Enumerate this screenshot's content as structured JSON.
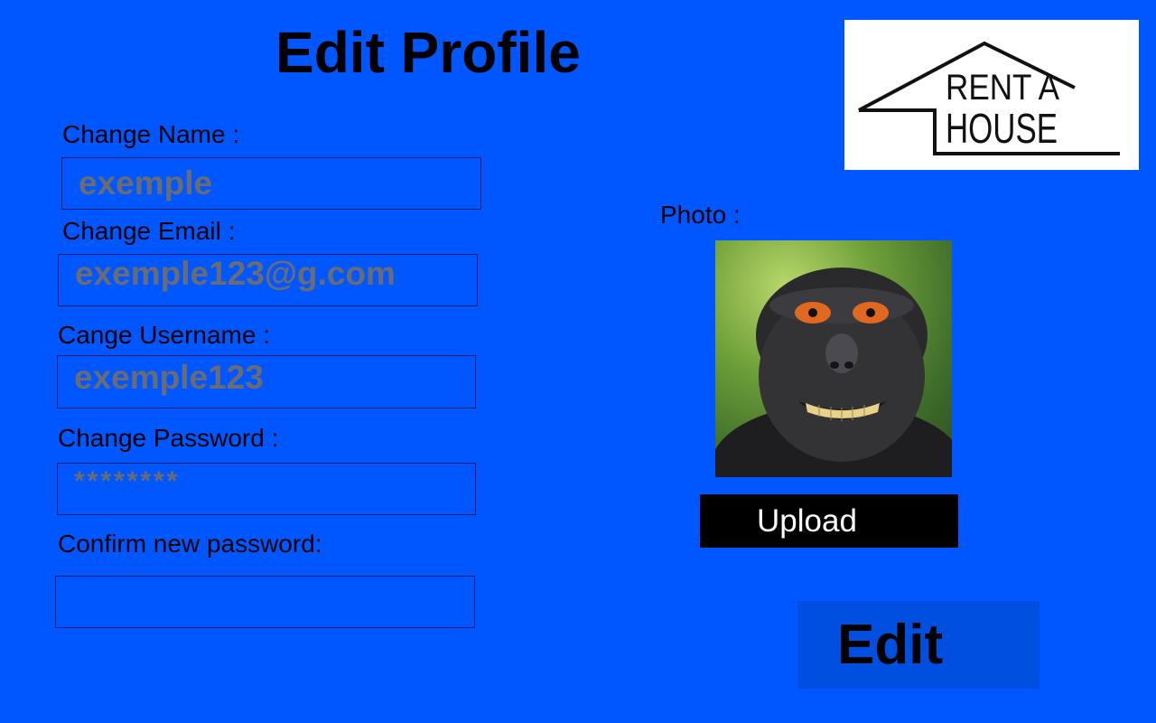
{
  "page": {
    "title": "Edit Profile",
    "background_color": "#0057ff"
  },
  "logo": {
    "line1": "RENT A",
    "line2": "HOUSE",
    "icon": "house-outline-icon"
  },
  "form": {
    "name_label": "Change Name :",
    "name_value": "exemple",
    "email_label": "Change Email :",
    "email_value": "exemple123@g.com",
    "username_label": "Cange Username :",
    "username_value": "exemple123",
    "password_label": "Change Password :",
    "password_value": "********",
    "confirm_label": "Confirm new password:",
    "confirm_value": ""
  },
  "photo": {
    "label": "Photo :",
    "upload_label": "Upload"
  },
  "actions": {
    "edit_label": "Edit",
    "edit_color": "#004fe0",
    "upload_color": "#000000"
  }
}
